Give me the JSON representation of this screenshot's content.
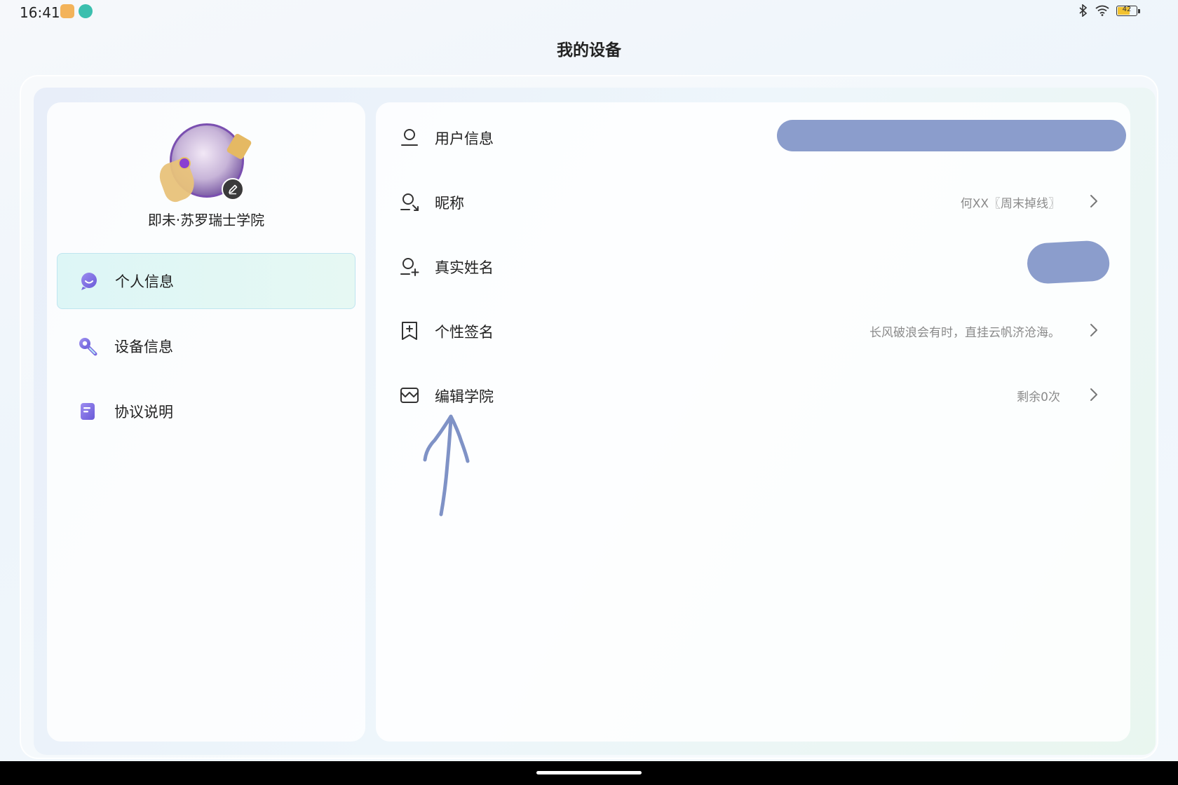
{
  "status_bar": {
    "time": "16:41",
    "battery_level": "42",
    "icons": [
      "bluetooth-icon",
      "wifi-icon",
      "battery-icon"
    ]
  },
  "page": {
    "title": "我的设备"
  },
  "profile": {
    "name": "即未·苏罗瑞士学院",
    "avatar_icon": "avatar-image",
    "edit_icon": "pencil-icon"
  },
  "sidebar": {
    "items": [
      {
        "label": "个人信息",
        "icon": "chat-bubble-icon",
        "active": true
      },
      {
        "label": "设备信息",
        "icon": "wrench-icon",
        "active": false
      },
      {
        "label": "协议说明",
        "icon": "document-icon",
        "active": false
      }
    ]
  },
  "details": {
    "rows": [
      {
        "label": "用户信息",
        "icon": "user-icon",
        "value": ""
      },
      {
        "label": "昵称",
        "icon": "user-edit-icon",
        "value": "何XX〖周末掉线〗"
      },
      {
        "label": "真实姓名",
        "icon": "user-add-icon",
        "value": ""
      },
      {
        "label": "个性签名",
        "icon": "signature-icon",
        "value": "长风破浪会有时，直挂云帆济沧海。"
      },
      {
        "label": "编辑学院",
        "icon": "academy-icon",
        "value": "剩余0次"
      }
    ]
  },
  "colors": {
    "accent": "#8b9dcc",
    "active_bg": "#ddf6f6",
    "icon_purple": "#7b6be0"
  }
}
